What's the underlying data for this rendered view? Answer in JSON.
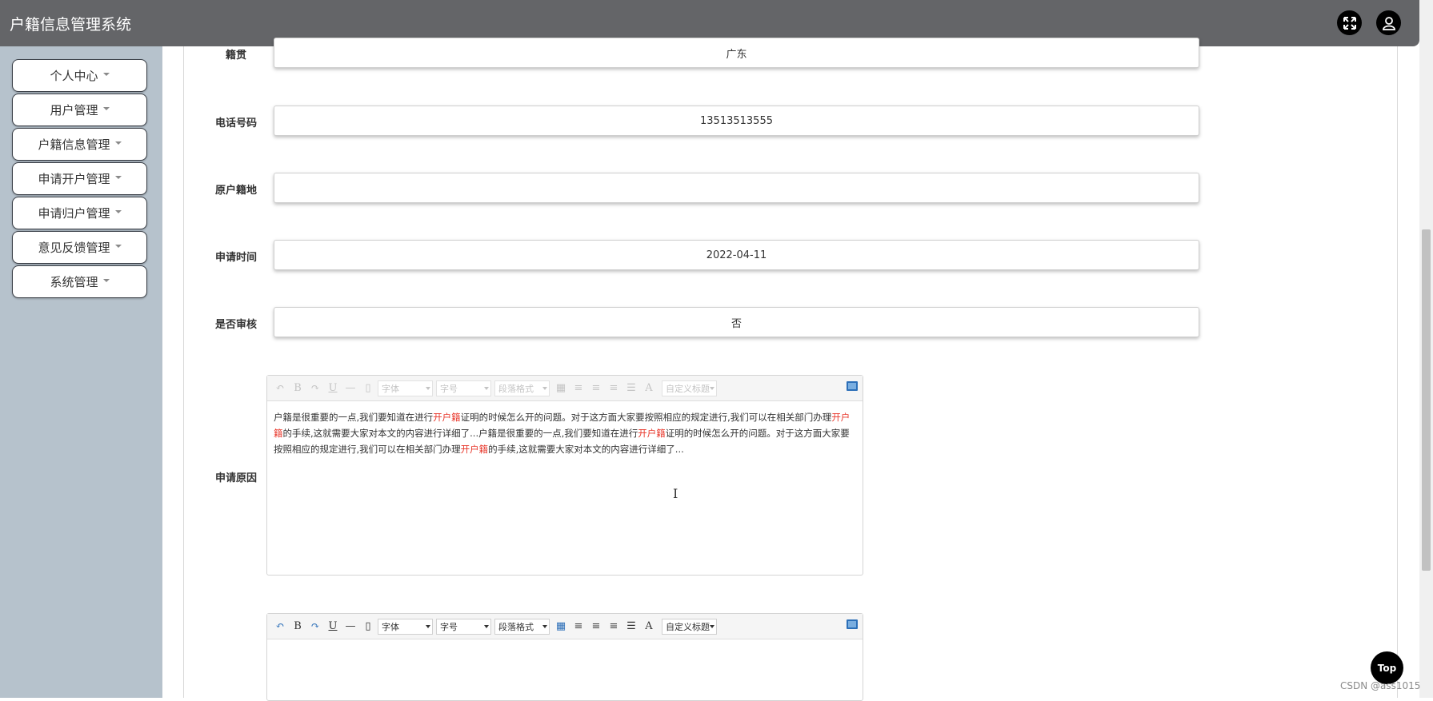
{
  "app": {
    "title": "户籍信息管理系统"
  },
  "header": {
    "fullscreen_icon": "fullscreen-icon",
    "user_icon": "user-icon"
  },
  "sidebar": {
    "items": [
      {
        "label": "个人中心"
      },
      {
        "label": "用户管理"
      },
      {
        "label": "户籍信息管理"
      },
      {
        "label": "申请开户管理"
      },
      {
        "label": "申请归户管理"
      },
      {
        "label": "意见反馈管理"
      },
      {
        "label": "系统管理"
      }
    ]
  },
  "form": {
    "native_place": {
      "label": "籍贯",
      "value": "广东"
    },
    "phone": {
      "label": "电话号码",
      "value": "13513513555"
    },
    "original_residence": {
      "label": "原户籍地",
      "value": ""
    },
    "apply_time": {
      "label": "申请时间",
      "value": "2022-04-11"
    },
    "approved": {
      "label": "是否审核",
      "value": "否"
    },
    "reason": {
      "label": "申请原因",
      "text_parts": [
        "户籍是很重要的一点,我们要知道在进行",
        "开户籍",
        "证明的时候怎么开的问题。对于这方面大家要按照相应的规定进行,我们可以在相关部门办理",
        "开户籍",
        "的手续,这就需要大家对本文的内容进行详细了...户籍是很重要的一点,我们要知道在进行",
        "开户籍",
        "证明的时候怎么开的问题。对于这方面大家要按照相应的规定进行,我们可以在相关部门办理",
        "开户籍",
        "的手续,这就需要大家对本文的内容进行详细了..."
      ]
    }
  },
  "editor_toolbar": {
    "bold": "B",
    "underline": "U",
    "font_family": "字体",
    "font_size": "字号",
    "paragraph": "段落格式",
    "font_color": "A",
    "custom_title": "自定义标题"
  },
  "top_button": {
    "label": "Top"
  },
  "watermark": "CSDN @ass1015"
}
